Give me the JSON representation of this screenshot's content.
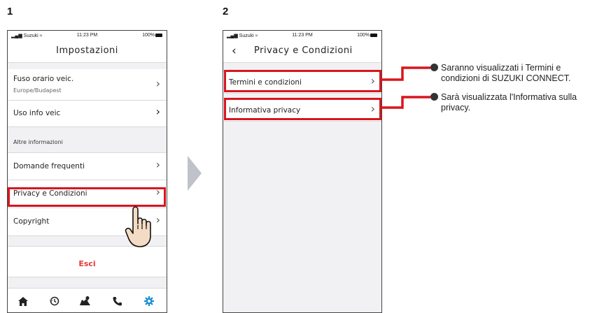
{
  "steps": [
    "1",
    "2"
  ],
  "status": {
    "carrier": "Suzuki",
    "time": "11:23 PM",
    "battery": "100%"
  },
  "screen1": {
    "title": "Impostazioni",
    "rows": [
      {
        "label": "Fuso orario veic.",
        "sub": "Europe/Budapest"
      },
      {
        "label": "Uso info veic"
      },
      {
        "label": "Domande frequenti"
      },
      {
        "label": "Privacy e Condizioni"
      },
      {
        "label": "Copyright"
      }
    ],
    "section": "Altre informazioni",
    "logout": "Esci",
    "nav_icons": [
      "home-icon",
      "history-icon",
      "map-icon",
      "phone-icon",
      "settings-icon"
    ]
  },
  "screen2": {
    "title": "Privacy e Condizioni",
    "rows": [
      {
        "label": "Termini e condizioni"
      },
      {
        "label": "Informativa privacy"
      }
    ]
  },
  "callouts": [
    {
      "line1": "Saranno visualizzati i Termini e",
      "line2": "condizioni di SUZUKI CONNECT."
    },
    {
      "line1": "Sarà visualizzata l'Informativa sulla",
      "line2": "privacy."
    }
  ],
  "colors": {
    "highlight": "#d7161e",
    "accent": "#1a8fd6",
    "logout": "#e53935",
    "arrow": "#bfc3c9"
  }
}
